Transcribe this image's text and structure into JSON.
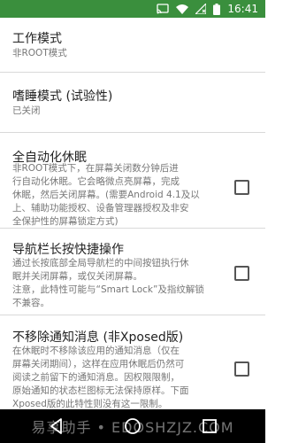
{
  "status_bar": {
    "time": "16:41",
    "icons": [
      "cast-icon",
      "wifi-icon",
      "no-sim-icon",
      "battery-icon"
    ],
    "color": "#3a8f3d"
  },
  "settings": [
    {
      "title": "工作模式",
      "summary_lines": [
        "非ROOT模式"
      ],
      "has_checkbox": false
    },
    {
      "title": "嗜睡模式 (试验性)",
      "summary_lines": [
        "已关闭"
      ],
      "has_checkbox": false
    },
    {
      "title": "全自动化休眠",
      "summary_lines": [
        "非ROOT模式下，在屏幕关闭数分钟后进",
        "行自动化休眠。它会略微点亮屏幕，完成",
        "休眠，然后关闭屏幕。(需要Android 4.1及以",
        "上、辅助功能授权、设备管理器授权及非安",
        "全保护性的屏幕锁定方式)"
      ],
      "has_checkbox": true,
      "checked": false
    },
    {
      "title": "导航栏长按快捷操作",
      "summary_lines": [
        "通过长按底部全局导航栏的中间按钮执行休",
        "眠并关闭屏幕，或仅关闭屏幕。",
        "注意，此特性可能与“Smart Lock”及指纹解锁",
        "不兼容。"
      ],
      "has_checkbox": true,
      "checked": false
    },
    {
      "title": "不移除通知消息 (非Xposed版)",
      "summary_lines": [
        "在休眠时不移除该应用的通知消息（仅在",
        "屏幕关闭期间），这样在应用休眠后仍然可",
        "阅读之前留下的通知消息。因权限限制，",
        "原始通知的状态栏图标无法保持原样。下面",
        "Xposed版的此特性则没有这一限制。"
      ],
      "has_checkbox": true,
      "checked": false
    }
  ],
  "nav_bar": {
    "buttons": [
      "back-icon",
      "home-icon",
      "recents-icon"
    ]
  },
  "watermark": "易享助手 • EDOSHZJZ.COM"
}
